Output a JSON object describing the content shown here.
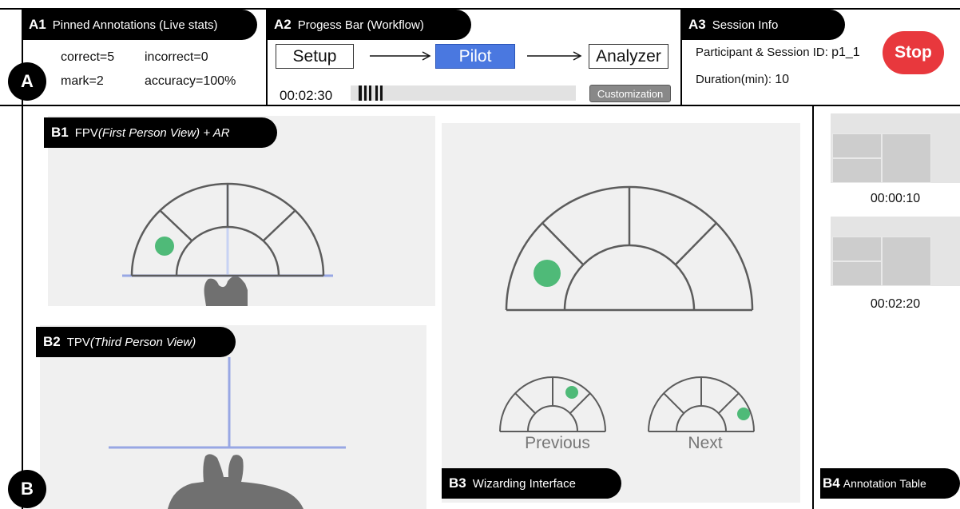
{
  "a1": {
    "code": "A1",
    "title": "Pinned Annotations (Live stats)",
    "correct": "correct=5",
    "incorrect": "incorrect=0",
    "mark": "mark=2",
    "accuracy": "accuracy=100%"
  },
  "a2": {
    "code": "A2",
    "title": "Progess Bar (Workflow)",
    "steps": [
      "Setup",
      "Pilot",
      "Analyzer"
    ],
    "active_step": "Pilot",
    "time": "00:02:30",
    "customization": "Customization"
  },
  "a3": {
    "code": "A3",
    "title": "Session Info",
    "participant_label": "Participant & Session ID:",
    "participant_id": "p1_1",
    "duration_label": "Duration(min):",
    "duration": "10",
    "stop": "Stop"
  },
  "section_a": "A",
  "section_b": "B",
  "b1": {
    "code": "B1",
    "title": "FPV",
    "subtitle": "(First Person View) + AR"
  },
  "b2": {
    "code": "B2",
    "title": "TPV",
    "subtitle": "(Third Person View)"
  },
  "b3": {
    "code": "B3",
    "title": "Wizarding Interface",
    "previous": "Previous",
    "next": "Next"
  },
  "b4": {
    "code": "B4",
    "title": "Annotation Table",
    "timestamps": [
      "00:00:10",
      "00:02:20"
    ]
  },
  "colors": {
    "accent_blue": "#4a78e0",
    "stop_red": "#e8383d",
    "dot_green": "#4fba78",
    "panel_gray": "#f0f0f0"
  }
}
